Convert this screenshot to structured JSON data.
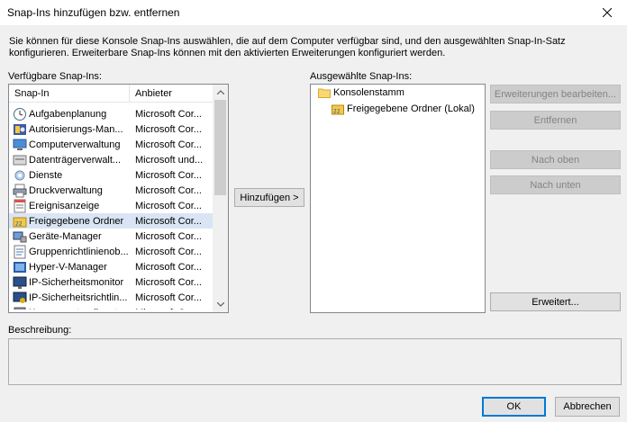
{
  "window": {
    "title": "Snap-Ins hinzufügen bzw. entfernen"
  },
  "intro": "Sie können für diese Konsole Snap-Ins auswählen, die auf dem Computer verfügbar sind, und den ausgewählten Snap-In-Satz konfigurieren. Erweiterbare Snap-Ins können mit den aktivierten Erweiterungen konfiguriert werden.",
  "available": {
    "label": "Verfügbare Snap-Ins:",
    "col_snapin": "Snap-In",
    "col_vendor": "Anbieter",
    "items": [
      {
        "name": "Aufgabenplanung",
        "vendor": "Microsoft Cor...",
        "icon": "clock-icon"
      },
      {
        "name": "Autorisierungs-Man...",
        "vendor": "Microsoft Cor...",
        "icon": "authorization-icon"
      },
      {
        "name": "Computerverwaltung",
        "vendor": "Microsoft Cor...",
        "icon": "computer-management-icon"
      },
      {
        "name": "Datenträgerverwalt...",
        "vendor": "Microsoft und...",
        "icon": "disk-management-icon"
      },
      {
        "name": "Dienste",
        "vendor": "Microsoft Cor...",
        "icon": "services-gear-icon"
      },
      {
        "name": "Druckverwaltung",
        "vendor": "Microsoft Cor...",
        "icon": "printer-icon"
      },
      {
        "name": "Ereignisanzeige",
        "vendor": "Microsoft Cor...",
        "icon": "event-viewer-icon"
      },
      {
        "name": "Freigegebene Ordner",
        "vendor": "Microsoft Cor...",
        "icon": "shared-folders-icon"
      },
      {
        "name": "Geräte-Manager",
        "vendor": "Microsoft Cor...",
        "icon": "device-manager-icon"
      },
      {
        "name": "Gruppenrichtlinienob...",
        "vendor": "Microsoft Cor...",
        "icon": "group-policy-icon"
      },
      {
        "name": "Hyper-V-Manager",
        "vendor": "Microsoft Cor...",
        "icon": "hyper-v-icon"
      },
      {
        "name": "IP-Sicherheitsmonitor",
        "vendor": "Microsoft Cor...",
        "icon": "ip-security-monitor-icon"
      },
      {
        "name": "IP-Sicherheitsrichtlin...",
        "vendor": "Microsoft Cor...",
        "icon": "ip-security-policy-icon"
      },
      {
        "name": "Komponentendienste",
        "vendor": "Microsoft Cor...",
        "icon": "component-services-icon"
      }
    ]
  },
  "add_button": "Hinzufügen >",
  "selected": {
    "label": "Ausgewählte Snap-Ins:",
    "root": "Konsolenstamm",
    "child": "Freigegebene Ordner (Lokal)"
  },
  "buttons": {
    "edit_extensions": "Erweiterungen bearbeiten...",
    "remove": "Entfernen",
    "move_up": "Nach oben",
    "move_down": "Nach unten",
    "advanced": "Erweitert...",
    "ok": "OK",
    "cancel": "Abbrechen"
  },
  "description": {
    "label": "Beschreibung:"
  },
  "colors": {
    "selection": "#d9e5f5",
    "default_button_border": "#0078d7",
    "window_background": "#f0f0f0"
  }
}
